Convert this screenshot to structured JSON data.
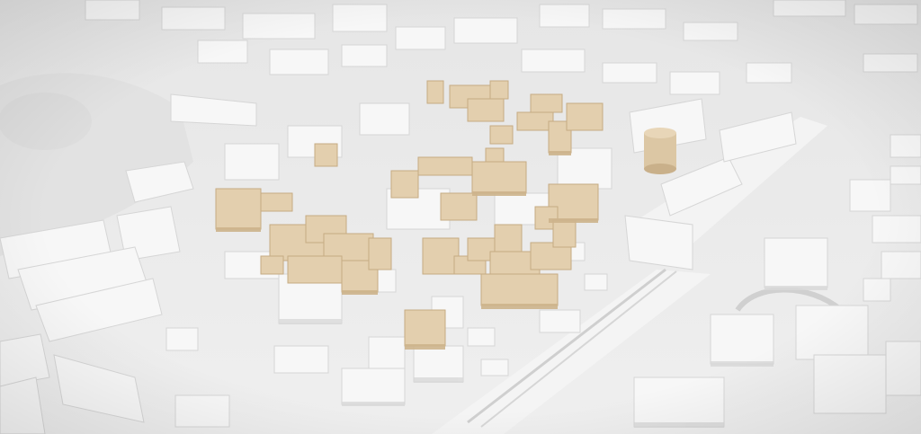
{
  "scene": {
    "subject": "urban-planning-model",
    "colors": {
      "ground": "#ebebeb",
      "ground_shadow": "#d9d9d9",
      "building_white": "#f7f7f7",
      "building_shade": "#dcdcdc",
      "wood_top": "#e3cfae",
      "wood_side": "#cdb48c",
      "road": "#f1f1f1"
    }
  }
}
